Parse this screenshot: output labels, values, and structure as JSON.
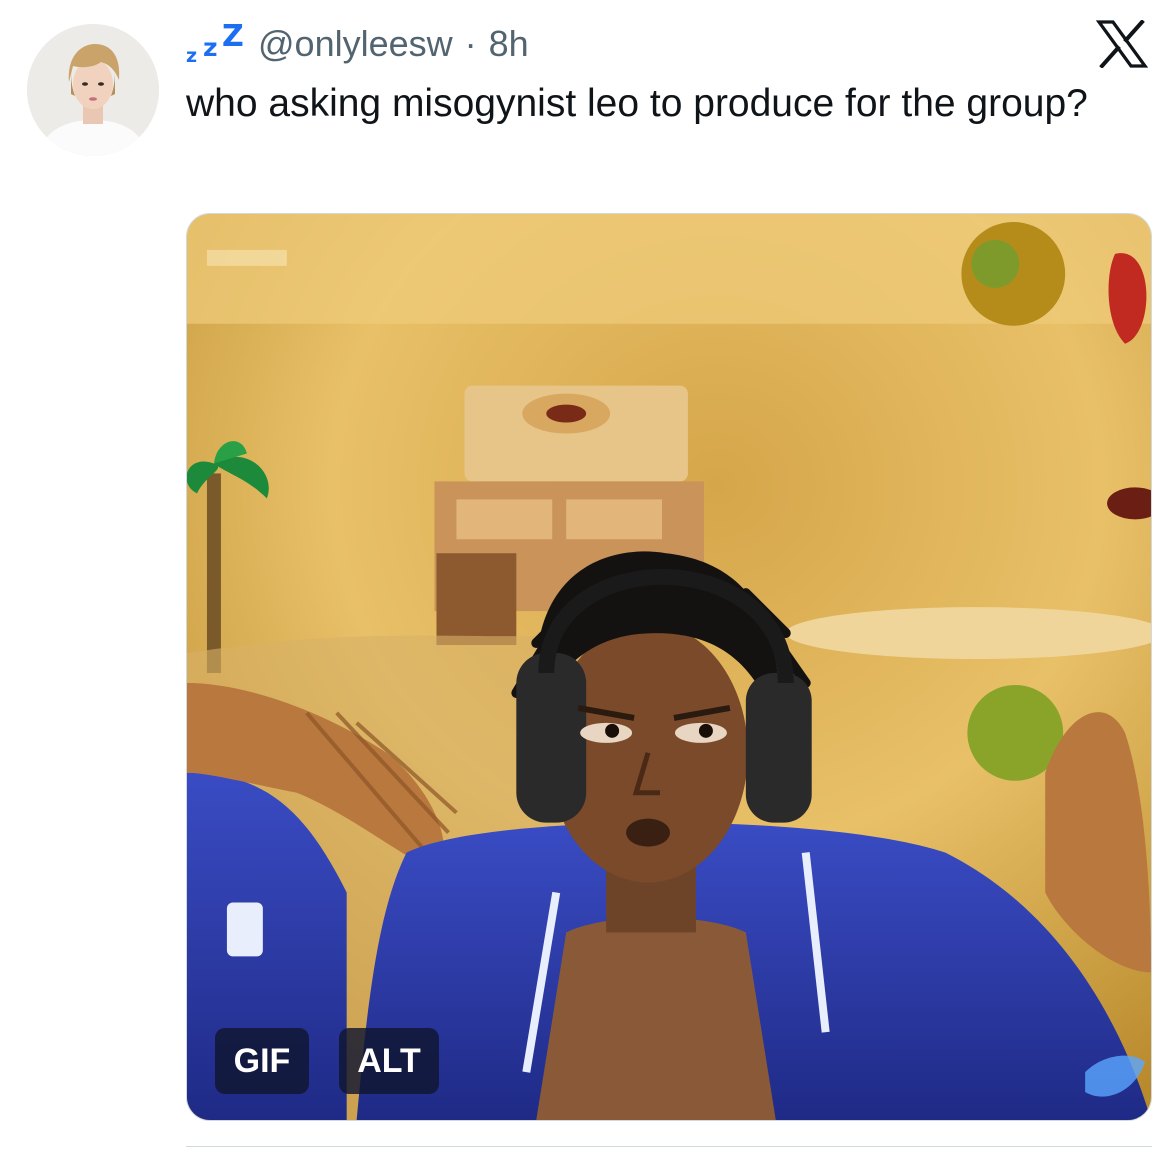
{
  "tweet": {
    "name_icon": "zzz-sleeping-emoji",
    "name_icon_text": [
      "z",
      "z",
      "Z"
    ],
    "handle": "@onlyleesw",
    "separator": "·",
    "time": "8h",
    "text": "who asking misogynist leo to produce for the group?",
    "media": {
      "type": "gif",
      "badges": {
        "gif": "GIF",
        "alt": "ALT"
      }
    }
  },
  "platform_logo": "x-logo",
  "colors": {
    "text_primary": "#0f1419",
    "text_secondary": "#536471",
    "zzz_blue": "#1d6ff2",
    "badge_bg": "#101630"
  }
}
